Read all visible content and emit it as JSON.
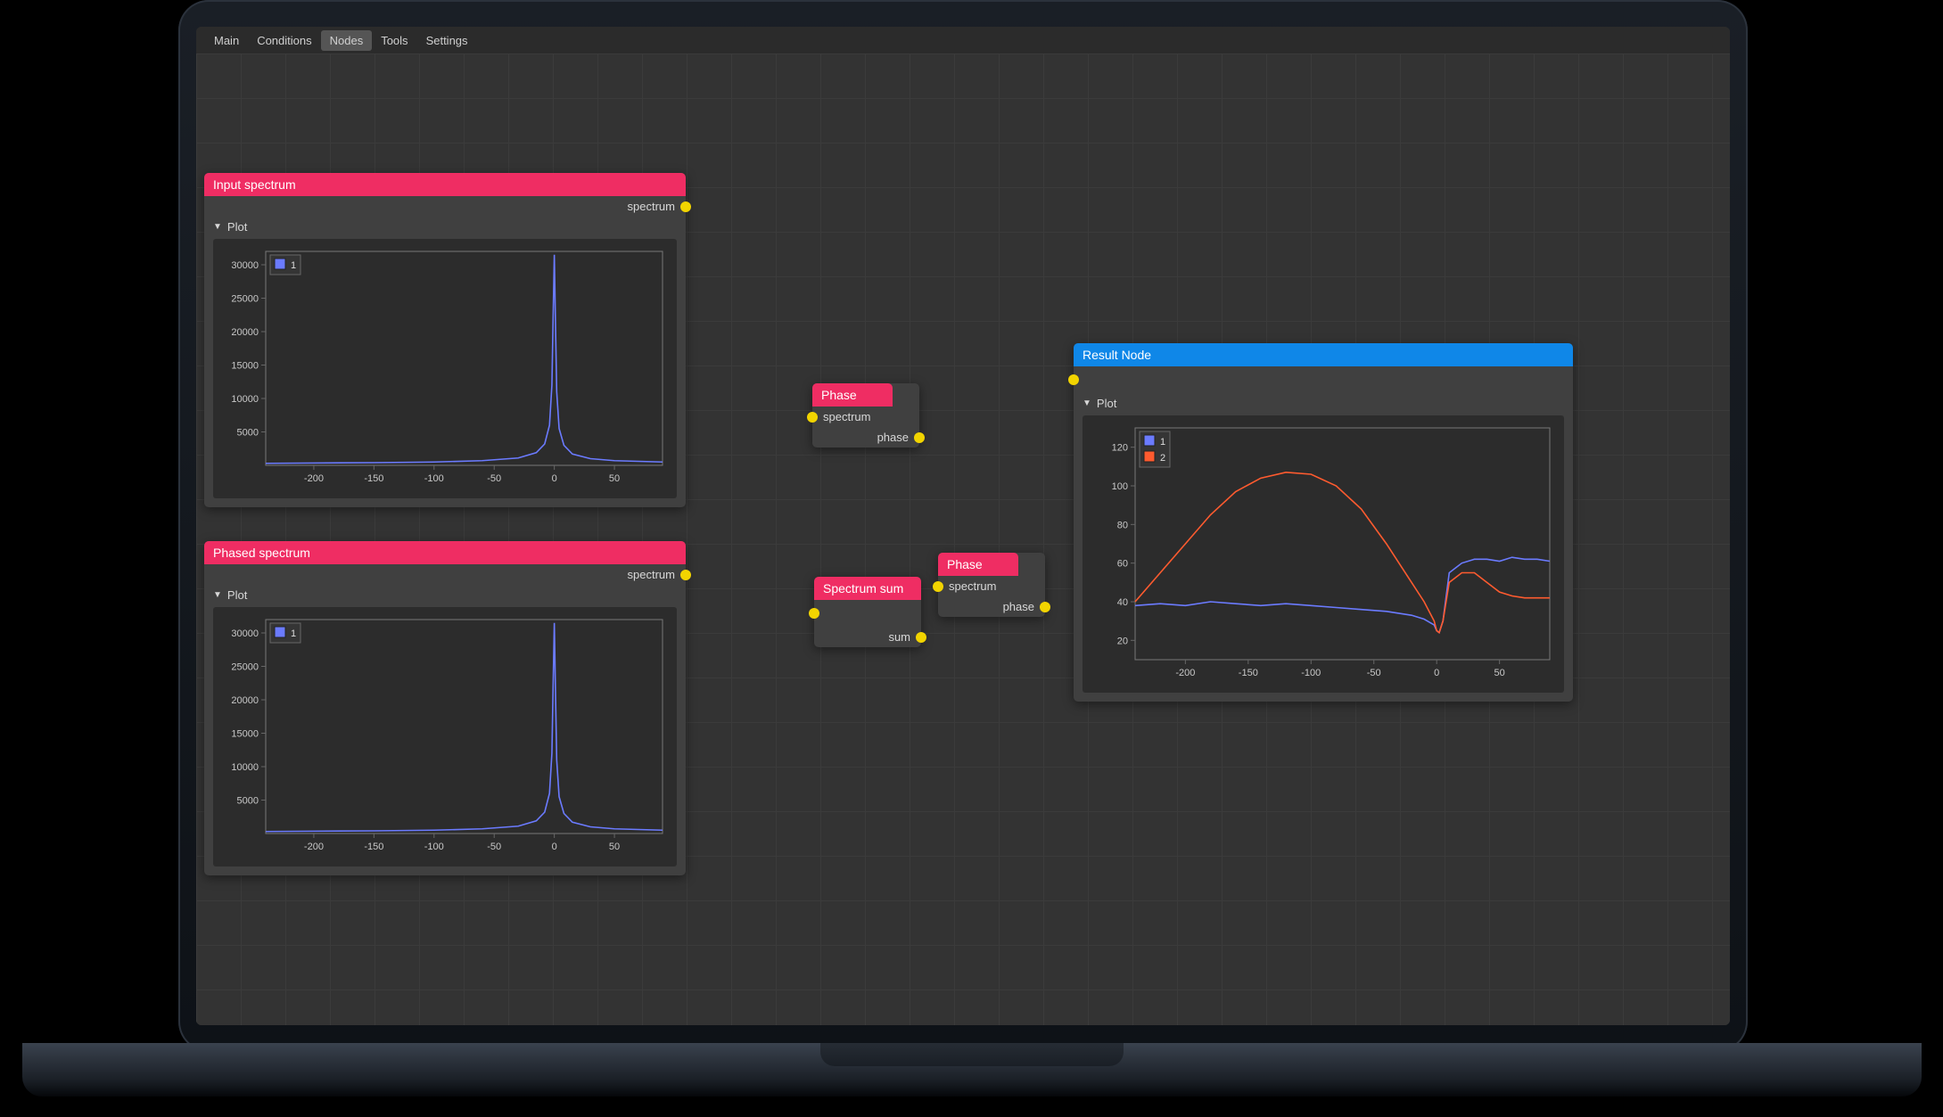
{
  "menubar": {
    "items": [
      "Main",
      "Conditions",
      "Nodes",
      "Tools",
      "Settings"
    ],
    "active_index": 2
  },
  "colors": {
    "node_pink": "#ef2d63",
    "node_blue": "#0f87e8",
    "wire": "#f2d400",
    "series1": "#6b7bff",
    "series2": "#ff5b2f"
  },
  "nodes": {
    "input_spectrum": {
      "title": "Input spectrum",
      "port_out_label": "spectrum",
      "plot_label": "Plot",
      "legend": [
        {
          "name": "1",
          "color": "#6b7bff"
        }
      ]
    },
    "phased_spectrum": {
      "title": "Phased spectrum",
      "port_out_label": "spectrum",
      "plot_label": "Plot",
      "legend": [
        {
          "name": "1",
          "color": "#6b7bff"
        }
      ]
    },
    "phase1": {
      "title": "Phase",
      "port_in_label": "spectrum",
      "port_out_label": "phase"
    },
    "spectrum_sum": {
      "title": "Spectrum sum",
      "port_out_label": "sum"
    },
    "phase2": {
      "title": "Phase",
      "port_in_label": "spectrum",
      "port_out_label": "phase"
    },
    "result": {
      "title": "Result Node",
      "plot_label": "Plot",
      "legend": [
        {
          "name": "1",
          "color": "#6b7bff"
        },
        {
          "name": "2",
          "color": "#ff5b2f"
        }
      ]
    }
  },
  "chart_data": [
    {
      "id": "input_spectrum_plot",
      "type": "line",
      "xlabel": "",
      "ylabel": "",
      "xlim": [
        -240,
        90
      ],
      "ylim": [
        0,
        32000
      ],
      "xticks": [
        -200,
        -150,
        -100,
        -50,
        0,
        50
      ],
      "yticks": [
        5000,
        10000,
        15000,
        20000,
        25000,
        30000
      ],
      "series": [
        {
          "name": "1",
          "color": "#6b7bff",
          "x": [
            -240,
            -200,
            -150,
            -100,
            -60,
            -30,
            -15,
            -8,
            -4,
            -2,
            -1,
            0,
            1,
            2,
            4,
            8,
            15,
            30,
            50,
            90
          ],
          "values": [
            300,
            350,
            400,
            500,
            700,
            1100,
            1900,
            3200,
            6000,
            12000,
            22000,
            31500,
            21000,
            11000,
            5500,
            3000,
            1700,
            1000,
            700,
            500
          ]
        }
      ]
    },
    {
      "id": "phased_spectrum_plot",
      "type": "line",
      "xlabel": "",
      "ylabel": "",
      "xlim": [
        -240,
        90
      ],
      "ylim": [
        0,
        32000
      ],
      "xticks": [
        -200,
        -150,
        -100,
        -50,
        0,
        50
      ],
      "yticks": [
        5000,
        10000,
        15000,
        20000,
        25000,
        30000
      ],
      "series": [
        {
          "name": "1",
          "color": "#6b7bff",
          "x": [
            -240,
            -200,
            -150,
            -100,
            -60,
            -30,
            -15,
            -8,
            -4,
            -2,
            -1,
            0,
            1,
            2,
            4,
            8,
            15,
            30,
            50,
            90
          ],
          "values": [
            300,
            350,
            400,
            500,
            700,
            1100,
            1900,
            3200,
            6000,
            12000,
            22000,
            31500,
            21000,
            11000,
            5500,
            3000,
            1700,
            1000,
            700,
            500
          ]
        }
      ]
    },
    {
      "id": "result_plot",
      "type": "line",
      "xlabel": "",
      "ylabel": "",
      "xlim": [
        -240,
        90
      ],
      "ylim": [
        10,
        130
      ],
      "xticks": [
        -200,
        -150,
        -100,
        -50,
        0,
        50
      ],
      "yticks": [
        20,
        40,
        60,
        80,
        100,
        120
      ],
      "series": [
        {
          "name": "1",
          "color": "#6b7bff",
          "x": [
            -240,
            -220,
            -200,
            -180,
            -160,
            -140,
            -120,
            -100,
            -80,
            -60,
            -40,
            -20,
            -10,
            -2,
            0,
            2,
            5,
            10,
            20,
            30,
            40,
            50,
            60,
            70,
            80,
            90
          ],
          "values": [
            38,
            39,
            38,
            40,
            39,
            38,
            39,
            38,
            37,
            36,
            35,
            33,
            31,
            28,
            25,
            24,
            30,
            55,
            60,
            62,
            62,
            61,
            63,
            62,
            62,
            61
          ]
        },
        {
          "name": "2",
          "color": "#ff5b2f",
          "x": [
            -240,
            -220,
            -200,
            -180,
            -160,
            -140,
            -120,
            -100,
            -80,
            -60,
            -40,
            -20,
            -10,
            -2,
            0,
            2,
            5,
            10,
            20,
            30,
            40,
            50,
            60,
            70,
            80,
            90
          ],
          "values": [
            40,
            55,
            70,
            85,
            97,
            104,
            107,
            106,
            100,
            88,
            70,
            50,
            40,
            30,
            25,
            24,
            30,
            50,
            55,
            55,
            50,
            45,
            43,
            42,
            42,
            42
          ]
        }
      ]
    }
  ]
}
